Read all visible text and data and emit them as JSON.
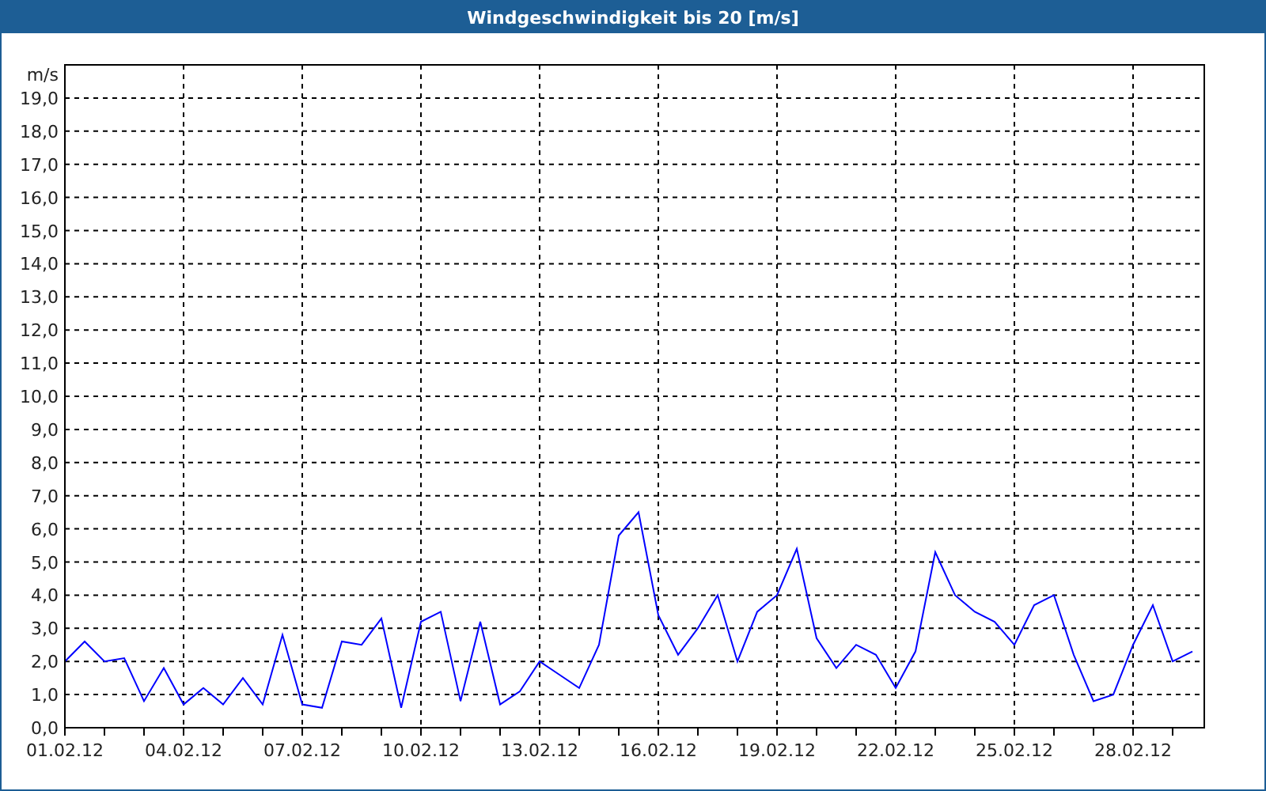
{
  "window": {
    "title": "Windgeschwindigkeit bis 20 [m/s]"
  },
  "chart_data": {
    "type": "line",
    "ylabel": "m/s",
    "grid": true,
    "ylim": [
      0,
      20
    ],
    "yticks": [
      {
        "value": 0,
        "label": "0,0"
      },
      {
        "value": 1,
        "label": "1,0"
      },
      {
        "value": 2,
        "label": "2,0"
      },
      {
        "value": 3,
        "label": "3,0"
      },
      {
        "value": 4,
        "label": "4,0"
      },
      {
        "value": 5,
        "label": "5,0"
      },
      {
        "value": 6,
        "label": "6,0"
      },
      {
        "value": 7,
        "label": "7,0"
      },
      {
        "value": 8,
        "label": "8,0"
      },
      {
        "value": 9,
        "label": "9,0"
      },
      {
        "value": 10,
        "label": "10,0"
      },
      {
        "value": 11,
        "label": "11,0"
      },
      {
        "value": 12,
        "label": "12,0"
      },
      {
        "value": 13,
        "label": "13,0"
      },
      {
        "value": 14,
        "label": "14,0"
      },
      {
        "value": 15,
        "label": "15,0"
      },
      {
        "value": 16,
        "label": "16,0"
      },
      {
        "value": 17,
        "label": "17,0"
      },
      {
        "value": 18,
        "label": "18,0"
      },
      {
        "value": 19,
        "label": "19,0"
      }
    ],
    "categories": [
      "01.02.12",
      null,
      null,
      null,
      null,
      null,
      "04.02.12",
      null,
      null,
      null,
      null,
      null,
      "07.02.12",
      null,
      null,
      null,
      null,
      null,
      "10.02.12",
      null,
      null,
      null,
      null,
      null,
      "13.02.12",
      null,
      null,
      null,
      null,
      null,
      "16.02.12",
      null,
      null,
      null,
      null,
      null,
      "19.02.12",
      null,
      null,
      null,
      null,
      null,
      "22.02.12",
      null,
      null,
      null,
      null,
      null,
      "25.02.12",
      null,
      null,
      null,
      null,
      null,
      "28.02.12",
      null,
      null,
      null
    ],
    "series": [
      {
        "color": "#0000ff",
        "values": [
          2.0,
          2.6,
          2.0,
          2.1,
          0.8,
          1.8,
          0.7,
          1.2,
          0.7,
          1.5,
          0.7,
          2.8,
          0.7,
          0.6,
          2.6,
          2.5,
          3.3,
          0.6,
          3.2,
          3.5,
          0.8,
          3.2,
          0.7,
          1.1,
          2.0,
          1.6,
          1.2,
          2.5,
          5.8,
          6.5,
          3.4,
          2.2,
          3.0,
          4.0,
          2.0,
          3.5,
          4.0,
          5.4,
          2.7,
          1.8,
          2.5,
          2.2,
          1.2,
          2.3,
          5.3,
          4.0,
          3.5,
          3.2,
          2.5,
          3.7,
          4.0,
          2.2,
          0.8,
          1.0,
          2.5,
          3.7,
          2.0,
          2.3
        ]
      }
    ]
  }
}
